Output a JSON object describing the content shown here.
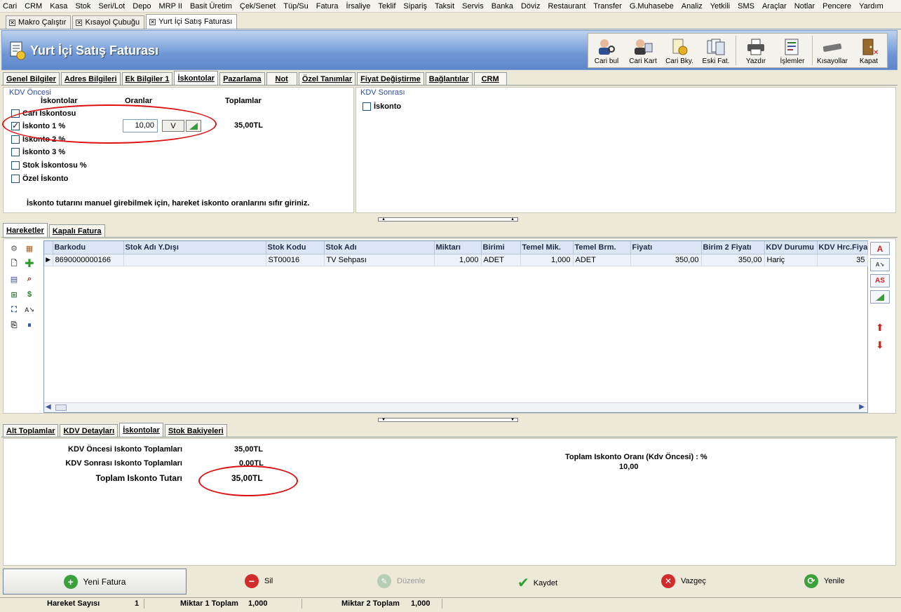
{
  "menu": [
    "Cari",
    "CRM",
    "Kasa",
    "Stok",
    "Seri/Lot",
    "Depo",
    "MRP II",
    "Basit Üretim",
    "Çek/Senet",
    "Tüp/Su",
    "Fatura",
    "İrsaliye",
    "Teklif",
    "Sipariş",
    "Taksit",
    "Servis",
    "Banka",
    "Döviz",
    "Restaurant",
    "Transfer",
    "G.Muhasebe",
    "Analiz",
    "Yetkili",
    "SMS",
    "Araçlar",
    "Notlar",
    "Pencere",
    "Yardım"
  ],
  "window_tabs": [
    "Makro Çalıştır",
    "Kısayol Çubuğu",
    "Yurt İçi Satış Faturası"
  ],
  "title": "Yurt İçi Satış Faturası",
  "toolbar": {
    "cari_bul": "Cari bul",
    "cari_kart": "Cari Kart",
    "cari_bky": "Cari Bky.",
    "eski_fat": "Eski Fat.",
    "yazdir": "Yazdır",
    "islemler": "İşlemler",
    "kisayollar": "Kısayollar",
    "kapat": "Kapat"
  },
  "top_tabs": [
    "Genel Bilgiler",
    "Adres Bilgileri",
    "Ek Bilgiler 1",
    "İskontolar",
    "Pazarlama",
    "Not",
    "Özel Tanımlar",
    "Fiyat Değiştirme",
    "Bağlantılar",
    "CRM"
  ],
  "kdv_oncesi": {
    "title": "KDV Öncesi",
    "col_iskontolar": "İskontolar",
    "col_oranlar": "Oranlar",
    "col_toplamlar": "Toplamlar",
    "rows": [
      "Cari İskontosu",
      "İskonto 1 %",
      "İskonto 2 %",
      "İskonto 3 %",
      "Stok İskontosu %",
      "Özel İskonto"
    ],
    "iskonto1_rate": "10,00",
    "iskonto1_total": "35,00TL",
    "v_button": "V",
    "note": "İskonto tutarını manuel girebilmek için, hareket iskonto oranlarını sıfır giriniz."
  },
  "kdv_sonrasi": {
    "title": "KDV Sonrası",
    "row": "İskonto"
  },
  "mid_tabs": [
    "Hareketler",
    "Kapalı Fatura"
  ],
  "grid": {
    "columns": [
      "Barkodu",
      "Stok Adı Y.Dışı",
      "Stok Kodu",
      "Stok Adı",
      "Miktarı",
      "Birimi",
      "Temel Mik.",
      "Temel Brm.",
      "Fiyatı",
      "Birim 2 Fiyatı",
      "KDV Durumu",
      "KDV Hrc.Fiya"
    ],
    "rows": [
      [
        "8690000000166",
        "",
        "ST00016",
        "TV Sehpası",
        "1,000",
        "ADET",
        "1,000",
        "ADET",
        "350,00",
        "350,00",
        "Hariç",
        "35"
      ]
    ]
  },
  "right_buttons": {
    "a": "A",
    "as": "AS"
  },
  "bottom_tabs": [
    "Alt Toplamlar",
    "KDV Detayları",
    "İskontolar",
    "Stok Bakiyeleri"
  ],
  "summary": {
    "kdv_oncesi_label": "KDV Öncesi Iskonto Toplamları",
    "kdv_oncesi_value": "35,00TL",
    "kdv_sonrasi_label": "KDV Sonrası Iskonto Toplamları",
    "kdv_sonrasi_value": "0,00TL",
    "toplam_label": "Toplam Iskonto Tutarı",
    "toplam_value": "35,00TL",
    "oran_label": "Toplam Iskonto Oranı (Kdv Öncesi) : %",
    "oran_value": "10,00"
  },
  "footer": {
    "yeni": "Yeni Fatura",
    "sil": "Sil",
    "duzenle": "Düzenle",
    "kaydet": "Kaydet",
    "vazgec": "Vazgeç",
    "yenile": "Yenile"
  },
  "status": {
    "hareket_label": "Hareket Sayısı",
    "hareket_value": "1",
    "miktar1_label": "Miktar 1 Toplam",
    "miktar1_value": "1,000",
    "miktar2_label": "Miktar 2 Toplam",
    "miktar2_value": "1,000"
  }
}
